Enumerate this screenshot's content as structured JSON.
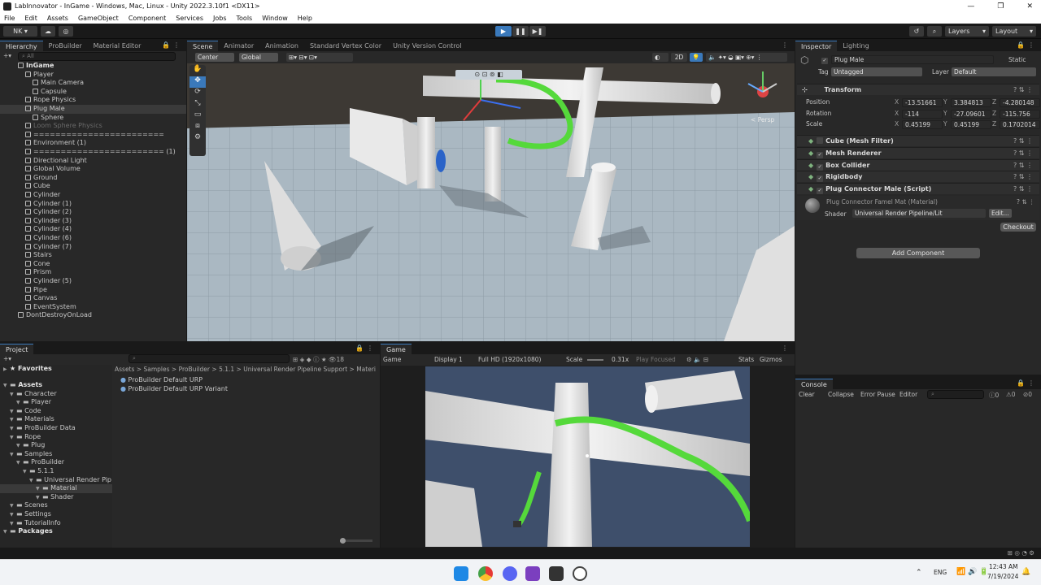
{
  "window": {
    "title": "LabInnovator - InGame - Windows, Mac, Linux - Unity 2022.3.10f1 <DX11>",
    "controls": [
      "—",
      "❐",
      "✕"
    ]
  },
  "menu": [
    "File",
    "Edit",
    "Assets",
    "GameObject",
    "Component",
    "Services",
    "Jobs",
    "Tools",
    "Window",
    "Help"
  ],
  "toolbar": {
    "account": "NK ▾",
    "layers": "Layers",
    "layout": "Layout"
  },
  "hierarchy": {
    "tabs": [
      "Hierarchy",
      "ProBuilder",
      "Material Editor"
    ],
    "search_placeholder": "All",
    "items": [
      {
        "label": "InGame",
        "depth": 0,
        "bold": true
      },
      {
        "label": "Player",
        "depth": 1
      },
      {
        "label": "Main Camera",
        "depth": 2
      },
      {
        "label": "Capsule",
        "depth": 2
      },
      {
        "label": "Rope Physics",
        "depth": 1
      },
      {
        "label": "Plug Male",
        "depth": 1,
        "selected": true
      },
      {
        "label": "Sphere",
        "depth": 2
      },
      {
        "label": "Loom Sphere Physics",
        "depth": 1,
        "dim": true
      },
      {
        "label": "========================",
        "depth": 1
      },
      {
        "label": "Environment (1)",
        "depth": 1
      },
      {
        "label": "======================== (1)",
        "depth": 1
      },
      {
        "label": "Directional Light",
        "depth": 1
      },
      {
        "label": "Global Volume",
        "depth": 1
      },
      {
        "label": "Ground",
        "depth": 1
      },
      {
        "label": "Cube",
        "depth": 1
      },
      {
        "label": "Cylinder",
        "depth": 1
      },
      {
        "label": "Cylinder (1)",
        "depth": 1
      },
      {
        "label": "Cylinder (2)",
        "depth": 1
      },
      {
        "label": "Cylinder (3)",
        "depth": 1
      },
      {
        "label": "Cylinder (4)",
        "depth": 1
      },
      {
        "label": "Cylinder (6)",
        "depth": 1
      },
      {
        "label": "Cylinder (7)",
        "depth": 1
      },
      {
        "label": "Stairs",
        "depth": 1
      },
      {
        "label": "Cone",
        "depth": 1
      },
      {
        "label": "Prism",
        "depth": 1
      },
      {
        "label": "Cylinder (5)",
        "depth": 1
      },
      {
        "label": "Pipe",
        "depth": 1
      },
      {
        "label": "Canvas",
        "depth": 1
      },
      {
        "label": "EventSystem",
        "depth": 1
      },
      {
        "label": "DontDestroyOnLoad",
        "depth": 0
      }
    ]
  },
  "scene": {
    "tabs": [
      "Scene",
      "Animator",
      "Animation",
      "Standard Vertex Color",
      "Unity Version Control"
    ],
    "pivot": "Center",
    "space": "Global",
    "mode_2d": "2D",
    "persp_label": "< Persp"
  },
  "inspector": {
    "tabs": [
      "Inspector",
      "Lighting"
    ],
    "object_name": "Plug Male",
    "static_label": "Static",
    "tag_label": "Tag",
    "tag_value": "Untagged",
    "layer_label": "Layer",
    "layer_value": "Default",
    "transform": {
      "title": "Transform",
      "rows": [
        {
          "label": "Position",
          "x": "-13.51661",
          "y": "3.384813",
          "z": "-4.280148"
        },
        {
          "label": "Rotation",
          "x": "-114",
          "y": "-27.09601",
          "z": "-115.756"
        },
        {
          "label": "Scale",
          "x": "0.45199",
          "y": "0.45199",
          "z": "0.1702014"
        }
      ]
    },
    "components": [
      "Cube (Mesh Filter)",
      "Mesh Renderer",
      "Box Collider",
      "Rigidbody",
      "Plug Connector Male (Script)"
    ],
    "material": {
      "name": "Plug Connector Famel Mat (Material)",
      "shader_label": "Shader",
      "shader_value": "Universal Render Pipeline/Lit",
      "edit_label": "Edit...",
      "checkout_label": "Checkout"
    },
    "add_component": "Add Component"
  },
  "project": {
    "tab": "Project",
    "count": "18",
    "favorites": "Favorites",
    "tree": [
      {
        "label": "Assets",
        "depth": 0,
        "bold": true
      },
      {
        "label": "Character",
        "depth": 1
      },
      {
        "label": "Player",
        "depth": 2
      },
      {
        "label": "Code",
        "depth": 1
      },
      {
        "label": "Materials",
        "depth": 1
      },
      {
        "label": "ProBuilder Data",
        "depth": 1
      },
      {
        "label": "Rope",
        "depth": 1
      },
      {
        "label": "Plug",
        "depth": 2
      },
      {
        "label": "Samples",
        "depth": 1
      },
      {
        "label": "ProBuilder",
        "depth": 2
      },
      {
        "label": "5.1.1",
        "depth": 3
      },
      {
        "label": "Universal Render Pip",
        "depth": 4
      },
      {
        "label": "Material",
        "depth": 5,
        "selected": true
      },
      {
        "label": "Shader",
        "depth": 5
      },
      {
        "label": "Scenes",
        "depth": 1
      },
      {
        "label": "Settings",
        "depth": 1
      },
      {
        "label": "TutorialInfo",
        "depth": 1
      },
      {
        "label": "Packages",
        "depth": 0,
        "bold": true
      }
    ],
    "breadcrumb": [
      "Assets",
      "Samples",
      "ProBuilder",
      "5.1.1",
      "Universal Render Pipeline Support",
      "Materi"
    ],
    "files": [
      "ProBuilder Default URP",
      "ProBuilder Default URP Variant"
    ]
  },
  "game": {
    "tab": "Game",
    "mode": "Game",
    "display": "Display 1",
    "resolution": "Full HD (1920x1080)",
    "scale_label": "Scale",
    "scale_value": "0.31x",
    "play_focused": "Play Focused",
    "stats": "Stats",
    "gizmos": "Gizmos"
  },
  "console": {
    "tab": "Console",
    "clear": "Clear",
    "collapse": "Collapse",
    "error_pause": "Error Pause",
    "editor": "Editor",
    "counts": [
      "0",
      "0",
      "0"
    ]
  },
  "taskbar": {
    "lang": "ENG",
    "time": "12:43 AM",
    "date": "7/19/2024"
  },
  "colors": {
    "selection": "#3a79bb",
    "rope": "#55d93b",
    "floor": "#aab8c2",
    "sky": "#3e4f6b"
  }
}
